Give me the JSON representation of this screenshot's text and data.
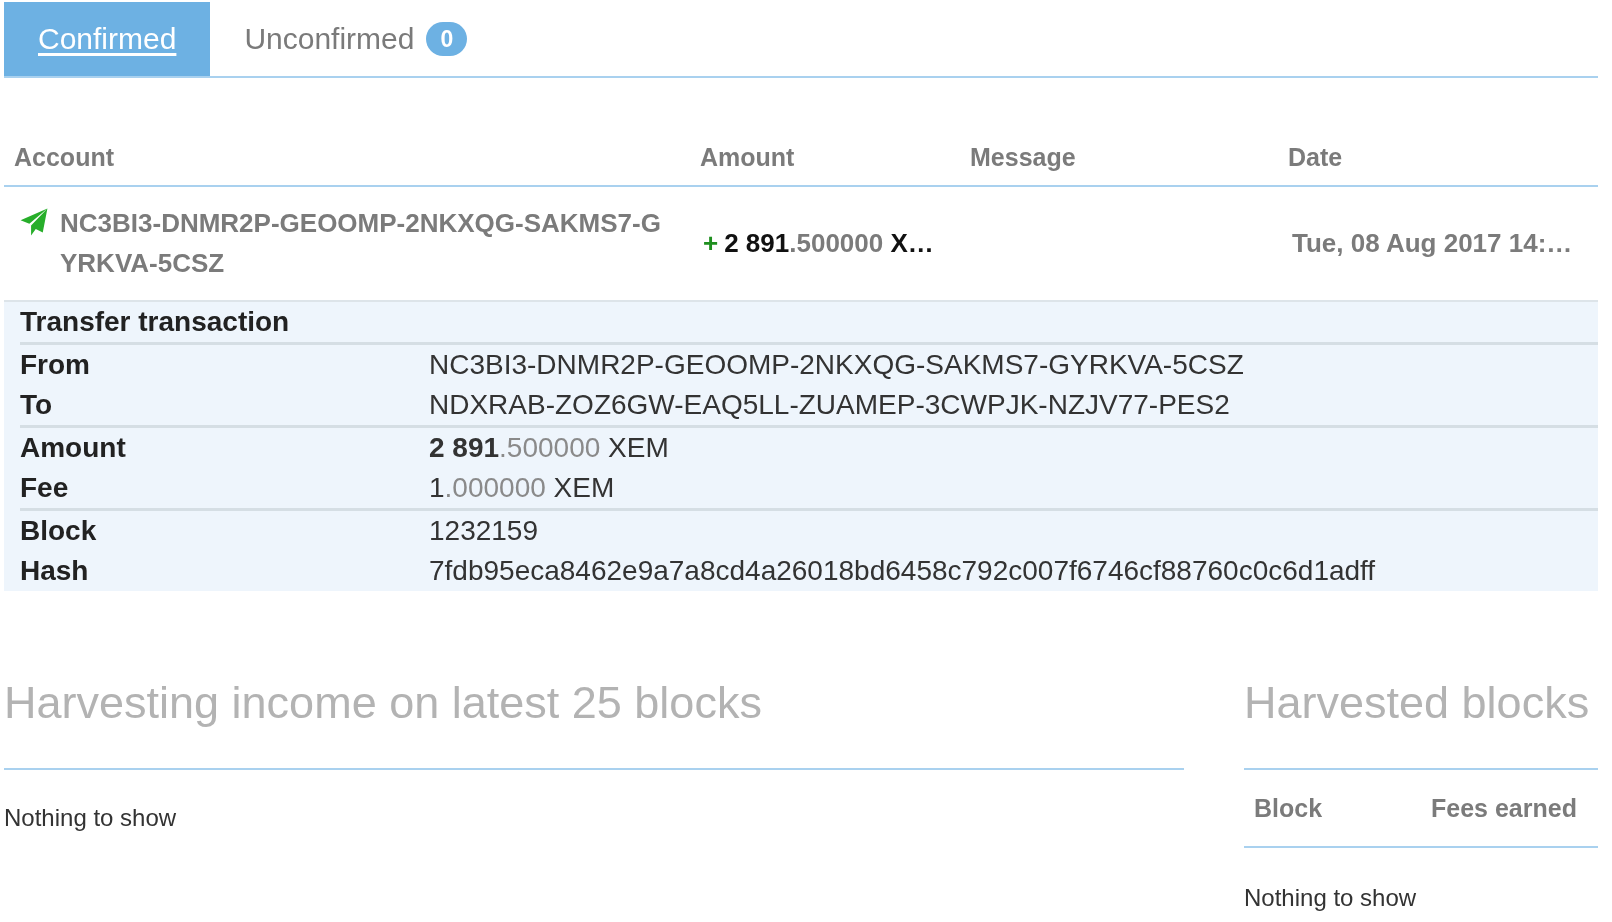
{
  "tabs": [
    {
      "label": "Confirmed",
      "selected": true
    },
    {
      "label": "Unconfirmed",
      "selected": false,
      "badge": "0"
    }
  ],
  "transactions": {
    "columns": [
      "Account",
      "Amount",
      "Message",
      "Date"
    ],
    "rows": [
      {
        "account": "NC3BI3-DNMR2P-GEOOMP-2NKXQG-SAKMS7-GYRKVA-5CSZ",
        "amount": {
          "sign": "+",
          "integer": "2 891",
          "fraction": ".500000",
          "unit": "X…"
        },
        "date": "Tue, 08 Aug 2017 14:…",
        "expanded": true,
        "details": {
          "title": "Transfer transaction",
          "groups": [
            {
              "rows": [
                {
                  "kind": "text",
                  "label": "From",
                  "value": "NC3BI3-DNMR2P-GEOOMP-2NKXQG-SAKMS7-GYRKVA-5CSZ"
                },
                {
                  "kind": "text",
                  "label": "To",
                  "value": "NDXRAB-ZOZ6GW-EAQ5LL-ZUAMEP-3CWPJK-NZJV77-PES2"
                }
              ]
            },
            {
              "rows": [
                {
                  "kind": "amount",
                  "label": "Amount",
                  "integer": "2 891",
                  "integer_bold": true,
                  "fraction": ".500000",
                  "unit": "XEM"
                },
                {
                  "kind": "amount",
                  "label": "Fee",
                  "integer": "1",
                  "integer_bold": false,
                  "fraction": ".000000",
                  "unit": "XEM"
                }
              ]
            },
            {
              "rows": [
                {
                  "kind": "text",
                  "label": "Block",
                  "value": "1232159"
                },
                {
                  "kind": "text",
                  "label": "Hash",
                  "value": "7fdb95eca8462e9a7a8cd4a26018bd6458c792c007f6746cf88760c0c6d1adff"
                }
              ]
            }
          ]
        }
      }
    ]
  },
  "harvesting_income": {
    "title": "Harvesting income on latest 25 blocks",
    "empty_text": "Nothing to show"
  },
  "harvested_blocks": {
    "title": "Harvested blocks",
    "columns": [
      "Block",
      "Fees earned"
    ],
    "empty_text": "Nothing to show"
  }
}
